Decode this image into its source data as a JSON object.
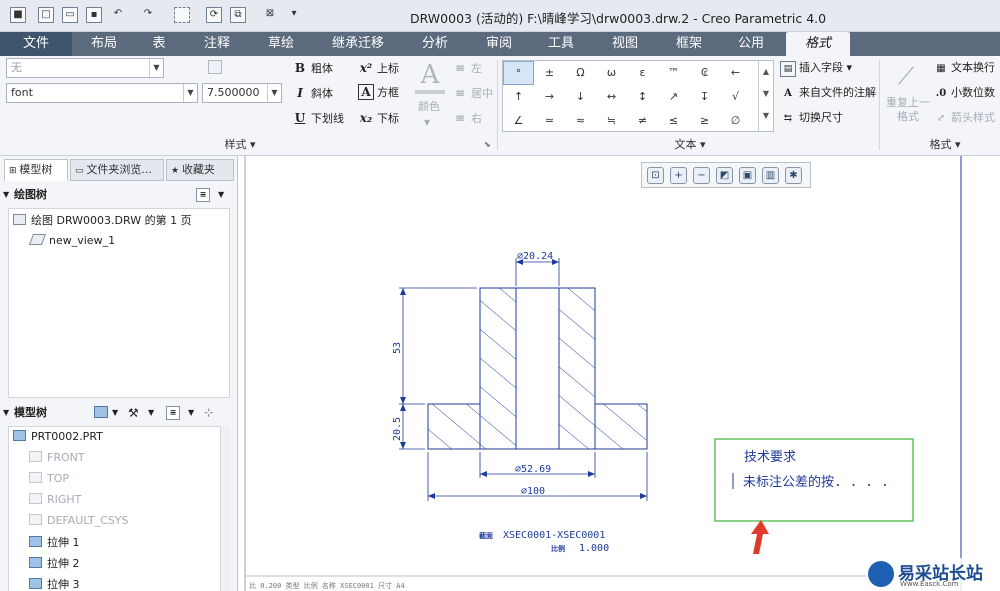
{
  "window": {
    "title": "DRW0003 (活动的) F:\\晴峰学习\\drw0003.drw.2 - Creo Parametric 4.0"
  },
  "tabs": [
    "文件",
    "布局",
    "表",
    "注释",
    "草绘",
    "继承迁移",
    "分析",
    "审阅",
    "工具",
    "视图",
    "框架",
    "公用",
    "格式"
  ],
  "ribbon": {
    "style_input": "无",
    "font_input": "font",
    "size_input": "7.500000",
    "bold": "粗体",
    "italic": "斜体",
    "underline": "下划线",
    "superscript": "上标",
    "box": "方框",
    "subscript": "下标",
    "color": "颜色",
    "align_left": "左",
    "align_center": "居中",
    "align_right": "右",
    "group_style": "样式",
    "symbols": [
      "°",
      "±",
      "Ω",
      "ω",
      "ɛ",
      "™",
      "₢",
      "←",
      "↑",
      "→",
      "↓",
      "↔",
      "↕",
      "↗",
      "↧",
      "√",
      "∠",
      "≃",
      "≈",
      "≒",
      "≠",
      "≤",
      "≥",
      "∅"
    ],
    "insert_field": "插入字段",
    "from_file": "来自文件的注解",
    "toggle_dim": "切换尺寸",
    "group_text": "文本",
    "repeat_last": "重复上一格式",
    "text_wrap": "文本换行",
    "decimal": "小数位数",
    "arrow_style": "箭头样式",
    "group_format": "格式"
  },
  "panel": {
    "tabs": [
      "模型树",
      "文件夹浏览...",
      "收藏夹"
    ],
    "drawing_tree_title": "绘图树",
    "drawing_items": [
      "绘图 DRW0003.DRW 的第 1 页",
      "new_view_1"
    ],
    "model_tree_title": "模型树",
    "model_items": [
      "PRT0002.PRT",
      "FRONT",
      "TOP",
      "RIGHT",
      "DEFAULT_CSYS",
      "拉伸 1",
      "拉伸 2",
      "拉伸 3"
    ]
  },
  "drawing": {
    "dims": {
      "top_dia": "∅20.24",
      "height_total": "53",
      "height_flange": "20.5",
      "mid_dia": "∅52.69",
      "bottom_dia": "∅100"
    },
    "section_label": "截面",
    "section_name": "XSEC0001-XSEC0001",
    "scale_label": "比例",
    "scale_value": "1.000",
    "note_title": "技术要求",
    "note_text": "未标注公差的按. . . .",
    "status_line": "比 0.200   类型 比例   名称 XSEC0001   尺寸 A4"
  },
  "watermark": {
    "text": "易采站长站",
    "url": "Www.Easck.Com"
  },
  "colors": {
    "tabbar": "#5b6a7d",
    "drawing_line": "#1f3a9a",
    "note_border": "#3db23a",
    "arrow": "#e03a2a"
  }
}
